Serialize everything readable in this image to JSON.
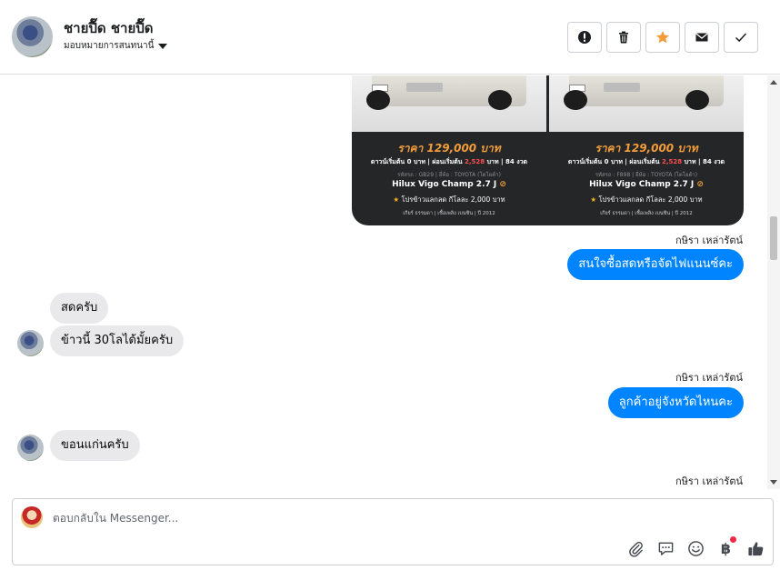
{
  "header": {
    "contact_name": "ชายปื๊ด ชายปื๊ด",
    "assign_label": "มอบหมายการสนทนานี้",
    "actions": [
      {
        "icon": "alert-icon"
      },
      {
        "icon": "trash-icon"
      },
      {
        "icon": "star-icon"
      },
      {
        "icon": "envelope-icon"
      },
      {
        "icon": "check-icon"
      }
    ]
  },
  "cards": [
    {
      "price": "ราคา 129,000 บาท",
      "terms_prefix": "ดาวน์เริ่มต้น 0 บาท | ผ่อนเริ่มต้น ",
      "monthly": "2,528",
      "terms_suffix": " บาท | 84 งวด",
      "meta": "รหัสรถ : GB29 | ยี่ห้อ : TOYOTA (โตโยต้า)",
      "model": "Hilux Vigo Champ 2.7 J",
      "promo": "โปรข้าวแลกลด กีโลละ 2,000 บาท",
      "footer": "เกียร์ ธรรมดา | เชื้อเพลิง เบนซิน | ปี 2012"
    },
    {
      "price": "ราคา 129,000 บาท",
      "terms_prefix": "ดาวน์เริ่มต้น 0 บาท | ผ่อนเริ่มต้น ",
      "monthly": "2,528",
      "terms_suffix": " บาท | 84 งวด",
      "meta": "รหัสรถ : F898 | ยี่ห้อ : TOYOTA (โตโยต้า)",
      "model": "Hilux Vigo Champ 2.7 J",
      "promo": "โปรข้าวแลกลด กีโลละ 2,000 บาท",
      "footer": "เกียร์ ธรรมดา | เชื้อเพลิง เบนซิน | ปี 2012"
    }
  ],
  "messages": {
    "agent_name_1": "กษิรา เหล่ารัตน์",
    "out_1": "สนใจซื้อสดหรือจัดไฟแนนซ์คะ",
    "in_1": "สดครับ",
    "in_2": "ข้าวนี้ 30โลได้มั้ยครับ",
    "agent_name_2": "กษิรา เหล่ารัตน์",
    "out_2": "ลูกค้าอยู่จังหวัดไหนคะ",
    "in_3": "ขอนแก่นครับ",
    "agent_name_3": "กษิรา เหล่ารัตน์"
  },
  "composer": {
    "placeholder": "ตอบกลับใน Messenger...",
    "tools": [
      "paperclip-icon",
      "saved-reply-icon",
      "emoji-icon",
      "baht-payment-icon",
      "thumbs-up-icon"
    ],
    "baht_symbol": "฿"
  },
  "colors": {
    "outgoing_bubble": "#0084ff",
    "incoming_bubble": "#e9e9eb",
    "star_accent": "#f39c3a",
    "notification_dot": "#f02849"
  }
}
